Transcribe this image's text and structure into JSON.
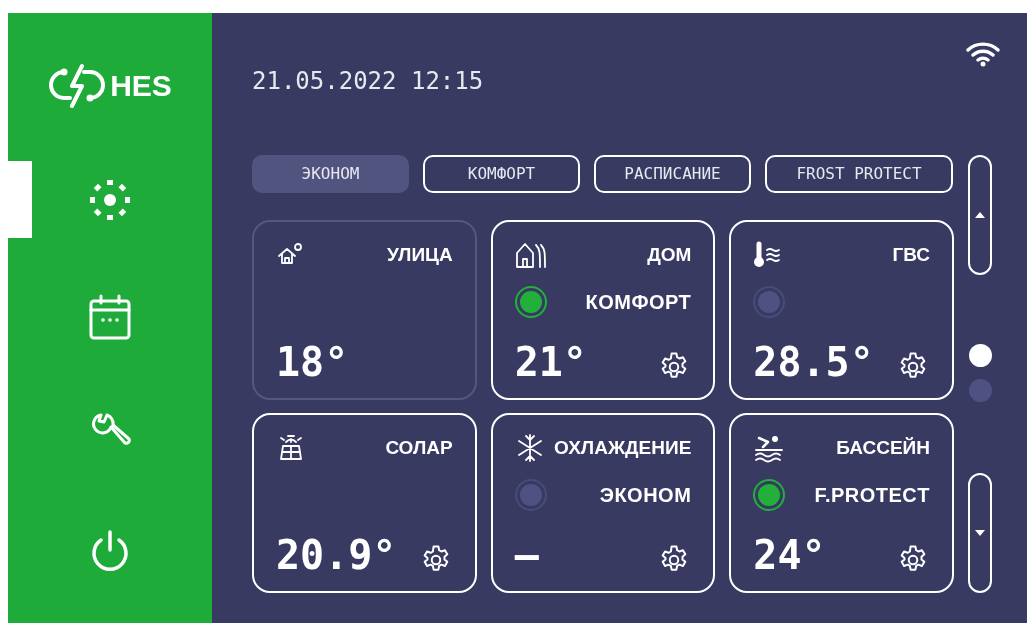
{
  "logo": {
    "text": "HES"
  },
  "sidebar": {
    "items": [
      {
        "kind": "sensors",
        "selected": true
      },
      {
        "kind": "calendar",
        "selected": false
      },
      {
        "kind": "service",
        "selected": false
      },
      {
        "kind": "power",
        "selected": false
      }
    ]
  },
  "header": {
    "datetime": "21.05.2022 12:15"
  },
  "modes": [
    {
      "label": "ЭКОНОМ",
      "selected": true
    },
    {
      "label": "КОМФОРТ",
      "selected": false
    },
    {
      "label": "РАСПИСАНИЕ",
      "selected": false
    },
    {
      "label": "FROST PROTECT",
      "selected": false
    }
  ],
  "cards": [
    {
      "kind": "outdoor",
      "title": "УЛИЦА",
      "active": false,
      "value": "18°"
    },
    {
      "kind": "house",
      "title": "ДОМ",
      "active": true,
      "indicator_on": true,
      "mode": "КОМФОРТ",
      "value": "21°",
      "settings": true
    },
    {
      "kind": "water",
      "title": "ГВС",
      "active": true,
      "indicator_on": false,
      "value": "28.5°",
      "settings": true
    },
    {
      "kind": "solar",
      "title": "СОЛАР",
      "active": true,
      "value": "20.9°",
      "settings": true
    },
    {
      "kind": "cooling",
      "title": "ОХЛАЖДЕНИЕ",
      "active": true,
      "indicator_on": false,
      "mode": "ЭКОНОМ",
      "value": "—",
      "settings": true
    },
    {
      "kind": "pool",
      "title": "БАССЕЙН",
      "active": true,
      "indicator_on": true,
      "mode": "F.PROTECT",
      "value": "24°",
      "settings": true
    }
  ],
  "pages": [
    {
      "selected": true
    },
    {
      "selected": false
    }
  ]
}
